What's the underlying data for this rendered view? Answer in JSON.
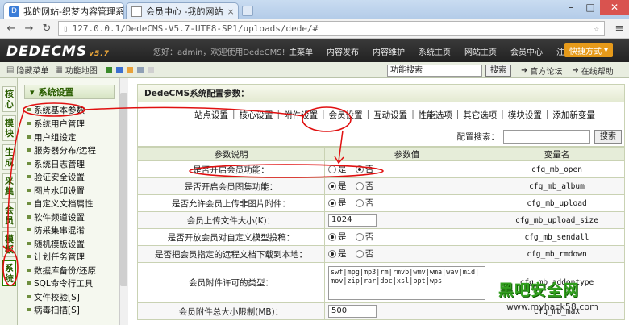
{
  "browser": {
    "tabs": [
      {
        "title": "我的网站-织梦内容管理系"
      },
      {
        "title": "会员中心 -我的网站"
      }
    ],
    "url": "127.0.0.1/DedeCMS-V5.7-UTF8-SP1/uploads/dede/#"
  },
  "header": {
    "logo": "DEDECMS",
    "logo_version": "v5.7",
    "welcome": "您好：admin，欢迎使用DedeCMS!",
    "menu": [
      "主菜单",
      "内容发布",
      "内容维护",
      "系统主页",
      "网站主页",
      "会员中心",
      "注销"
    ],
    "quick_button": "快捷方式"
  },
  "subbar": {
    "hide_menu": "隐藏菜单",
    "feature_map": "功能地图",
    "search_value": "功能搜索",
    "search_button": "搜索",
    "forum_link": "官方论坛",
    "help_link": "在线帮助",
    "swatch_colors": [
      "#3a8a2a",
      "#3b6fd0",
      "#e8a23a",
      "#8fa0b5",
      "#d0d0d0"
    ]
  },
  "left_tabs": [
    "核心",
    "模块",
    "生成",
    "采集",
    "会员",
    "模板",
    "系统"
  ],
  "sidebar": {
    "heading": "系统设置",
    "items": [
      "系统基本参数",
      "系统用户管理",
      "用户组设定",
      "服务器分布/远程",
      "系统日志管理",
      "验证安全设置",
      "图片水印设置",
      "自定义文档属性",
      "软件频道设置",
      "防采集串混淆",
      "随机模板设置",
      "计划任务管理",
      "数据库备份/还原",
      "SQL命令行工具",
      "文件校验[S]",
      "病毒扫描[S]"
    ]
  },
  "panel": {
    "title": "DedeCMS系统配置参数：",
    "tabs": [
      "站点设置",
      "核心设置",
      "附件设置",
      "会员设置",
      "互动设置",
      "性能选项",
      "其它选项",
      "模块设置",
      "添加新变量"
    ],
    "config_search_label": "配置搜索：",
    "config_search_button": "搜索"
  },
  "table": {
    "headers": [
      "参数说明",
      "参数值",
      "变量名"
    ],
    "yes": "是",
    "no": "否",
    "rows": [
      {
        "label": "是否开启会员功能：",
        "type": "radio",
        "value": "否",
        "var": "cfg_mb_open"
      },
      {
        "label": "是否开启会员图集功能：",
        "type": "radio",
        "value": "是",
        "var": "cfg_mb_album"
      },
      {
        "label": "是否允许会员上传非图片附件：",
        "type": "radio",
        "value": "是",
        "var": "cfg_mb_upload"
      },
      {
        "label": "会员上传文件大小(K)：",
        "type": "text",
        "value": "1024",
        "var": "cfg_mb_upload_size"
      },
      {
        "label": "是否开放会员对自定义模型投稿：",
        "type": "radio",
        "value": "是",
        "var": "cfg_mb_sendall"
      },
      {
        "label": "是否把会员指定的远程文档下载到本地：",
        "type": "radio",
        "value": "是",
        "var": "cfg_mb_rmdown"
      },
      {
        "label": "会员附件许可的类型：",
        "type": "textarea",
        "value": "swf|mpg|mp3|rm|rmvb|wmv|wma|wav|mid|mov|zip|rar|doc|xsl|ppt|wps",
        "var": "cfg_mb_addontype"
      },
      {
        "label": "会员附件总大小限制(MB)：",
        "type": "text",
        "value": "500",
        "var": "cfg_mb_max"
      }
    ]
  },
  "watermark": {
    "title": "黑吧安全网",
    "url": "www.myhack58.com"
  }
}
